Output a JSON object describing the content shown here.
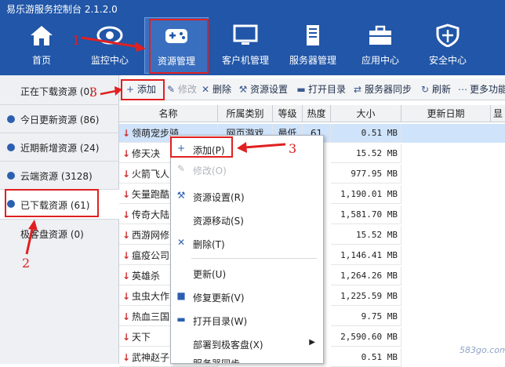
{
  "app": {
    "title": "易乐游服务控制台 2.1.2.0"
  },
  "nav": [
    {
      "label": "首页",
      "icon": "home-icon"
    },
    {
      "label": "监控中心",
      "icon": "eye-icon"
    },
    {
      "label": "资源管理",
      "icon": "gamepad-icon",
      "active": true
    },
    {
      "label": "客户机管理",
      "icon": "monitor-icon"
    },
    {
      "label": "服务器管理",
      "icon": "server-icon"
    },
    {
      "label": "应用中心",
      "icon": "toolbox-icon"
    },
    {
      "label": "安全中心",
      "icon": "shield-icon"
    }
  ],
  "sidebar": {
    "items": [
      {
        "label": "正在下载资源 (0)"
      },
      {
        "label": "今日更新资源 (86)"
      },
      {
        "label": "近期新增资源 (24)"
      },
      {
        "label": "云端资源 (3128)"
      },
      {
        "label": "已下载资源 (61)",
        "active": true
      },
      {
        "label": "极客盘资源 (0)"
      }
    ]
  },
  "toolbar": {
    "add": "添加",
    "edit": "修改",
    "delete": "删除",
    "settings": "资源设置",
    "open_dir": "打开目录",
    "sync": "服务器同步",
    "refresh": "刷新",
    "more": "更多功能"
  },
  "table": {
    "headers": [
      "名称",
      "所属类别",
      "等级",
      "热度值",
      "大小",
      "更新日期",
      "显"
    ],
    "rows": [
      {
        "name": "领萌宠步骑",
        "category": "网页游戏",
        "level": "最低",
        "heat": "61",
        "size": "0.51 MB"
      },
      {
        "name": "修天决",
        "size": "15.52 MB"
      },
      {
        "name": "火箭飞人",
        "size": "977.95 MB"
      },
      {
        "name": "矢量跑酷",
        "size": "1,190.01 MB"
      },
      {
        "name": "传奇大陆",
        "size": "1,581.70 MB"
      },
      {
        "name": "西游网修",
        "size": "15.52 MB"
      },
      {
        "name": "瘟疫公司",
        "size": "1,146.41 MB"
      },
      {
        "name": "英雄杀",
        "size": "1,264.26 MB"
      },
      {
        "name": "虫虫大作",
        "size": "1,225.59 MB"
      },
      {
        "name": "热血三国",
        "size": "9.75 MB"
      },
      {
        "name": "天下",
        "size": "2,590.60 MB"
      },
      {
        "name": "武神赵子",
        "size": "0.51 MB"
      }
    ]
  },
  "context_menu": {
    "items": [
      {
        "label": "添加(P)",
        "icon": "plus-icon"
      },
      {
        "label": "修改(O)",
        "icon": "pencil-icon",
        "disabled": true
      },
      {
        "label": "资源设置(R)",
        "icon": "wrench-icon"
      },
      {
        "label": "资源移动(S)",
        "icon": ""
      },
      {
        "label": "删除(T)",
        "icon": "x-icon"
      },
      {
        "label": "更新(U)",
        "icon": ""
      },
      {
        "label": "修复更新(V)",
        "icon": "square-icon"
      },
      {
        "label": "打开目录(W)",
        "icon": "folder-icon"
      },
      {
        "label": "部署到极客盘(X)",
        "icon": ""
      },
      {
        "label": "服务器同步",
        "icon": ""
      }
    ]
  },
  "annotations": {
    "one": "1",
    "two": "2",
    "three_a": "3",
    "three_b": "3"
  },
  "watermark": "583go.com",
  "colors": {
    "header_bg": "#2156a8",
    "accent": "#2c5fb0",
    "annotation": "#e02020",
    "selected_row": "#cfe3fb"
  }
}
